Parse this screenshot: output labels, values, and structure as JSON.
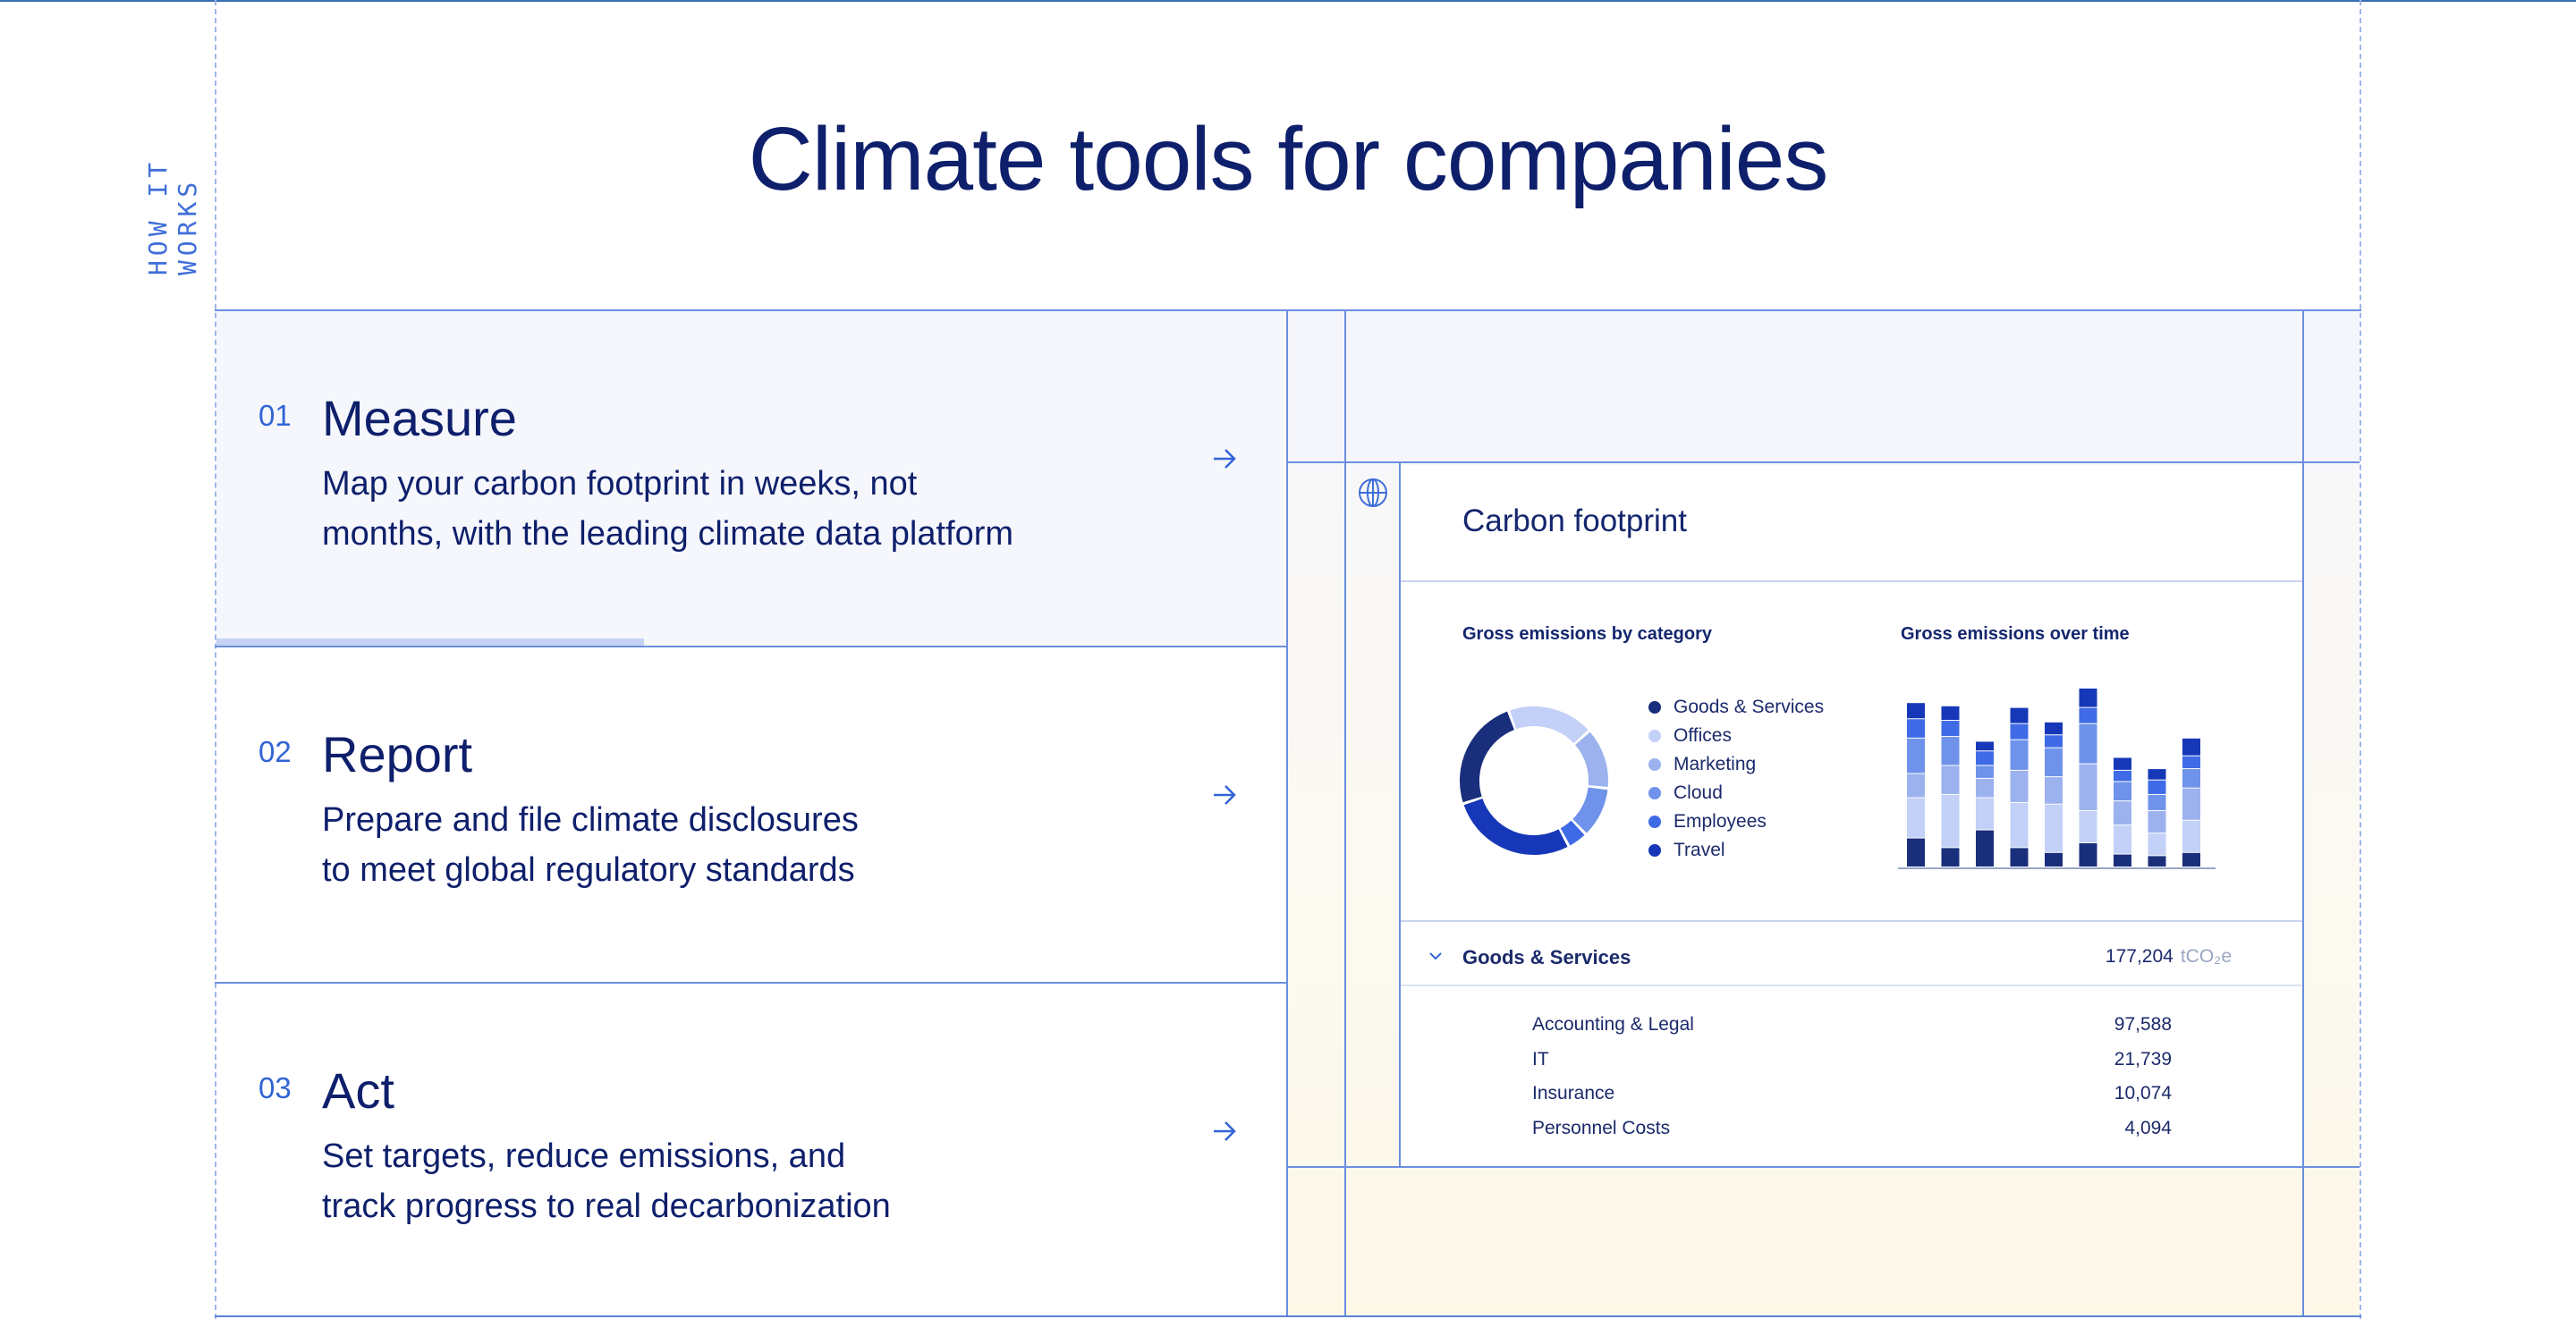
{
  "section_label": "HOW IT WORKS",
  "page_title": "Climate tools for companies",
  "steps": [
    {
      "number": "01",
      "title": "Measure",
      "desc_line1": "Map your carbon footprint in weeks, not",
      "desc_line2": "months, with the leading climate data platform"
    },
    {
      "number": "02",
      "title": "Report",
      "desc_line1": "Prepare and file climate disclosures",
      "desc_line2": "to meet global regulatory standards"
    },
    {
      "number": "03",
      "title": "Act",
      "desc_line1": "Set targets, reduce emissions, and",
      "desc_line2": "track progress to real decarbonization"
    }
  ],
  "active_step_progress": 0.4,
  "card": {
    "title": "Carbon footprint",
    "donut_title": "Gross emissions by category",
    "bars_title": "Gross emissions over time",
    "legend": [
      {
        "label": "Goods & Services",
        "color": "#1a2f7c"
      },
      {
        "label": "Offices",
        "color": "#c3d0f7"
      },
      {
        "label": "Marketing",
        "color": "#9bb2ee"
      },
      {
        "label": "Cloud",
        "color": "#6f93ea"
      },
      {
        "label": "Employees",
        "color": "#3f6be6"
      },
      {
        "label": "Travel",
        "color": "#1638b8"
      }
    ],
    "category_row": {
      "label": "Goods & Services",
      "value": "177,204",
      "unit": "tCO₂e"
    },
    "subrows": [
      {
        "label": "Accounting & Legal",
        "value": "97,588"
      },
      {
        "label": "IT",
        "value": "21,739"
      },
      {
        "label": "Insurance",
        "value": "10,074"
      },
      {
        "label": "Personnel Costs",
        "value": "4,094"
      }
    ]
  },
  "chart_data": [
    {
      "type": "pie",
      "title": "Gross emissions by category",
      "categories": [
        "Goods & Services",
        "Offices",
        "Marketing",
        "Cloud",
        "Employees",
        "Travel"
      ],
      "values": [
        22,
        17,
        12,
        10,
        4,
        25
      ]
    },
    {
      "type": "bar",
      "title": "Gross emissions over time",
      "categories": [
        "",
        "",
        "",
        "",
        "",
        "",
        "",
        "",
        ""
      ],
      "series": [
        {
          "name": "Goods & Services",
          "values": [
            18,
            12,
            23,
            12,
            9,
            15,
            8,
            7,
            9
          ]
        },
        {
          "name": "Offices",
          "values": [
            25,
            33,
            20,
            28,
            30,
            20,
            18,
            14,
            20
          ]
        },
        {
          "name": "Marketing",
          "values": [
            15,
            18,
            12,
            20,
            17,
            29,
            15,
            14,
            20
          ]
        },
        {
          "name": "Cloud",
          "values": [
            22,
            18,
            8,
            19,
            18,
            25,
            12,
            10,
            12
          ]
        },
        {
          "name": "Employees",
          "values": [
            12,
            10,
            9,
            10,
            8,
            10,
            7,
            9,
            8
          ]
        },
        {
          "name": "Travel",
          "values": [
            10,
            9,
            6,
            10,
            8,
            12,
            8,
            7,
            11
          ]
        }
      ]
    }
  ]
}
